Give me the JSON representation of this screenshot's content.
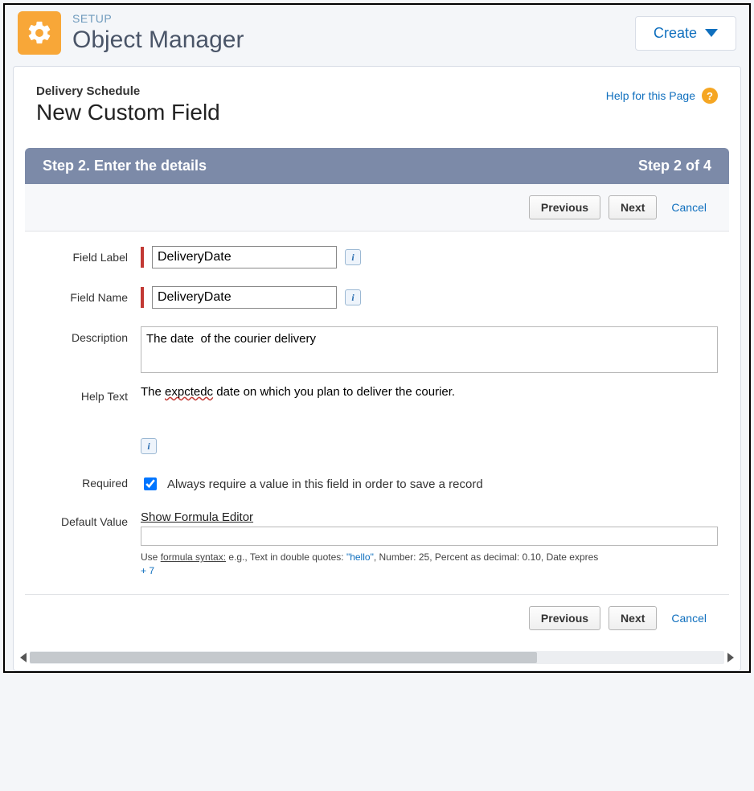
{
  "header": {
    "eyebrow": "SETUP",
    "title": "Object Manager",
    "create_label": "Create"
  },
  "panel": {
    "breadcrumb": "Delivery Schedule",
    "page_title": "New Custom Field",
    "help_link": "Help for this Page"
  },
  "step": {
    "left": "Step 2. Enter the details",
    "right": "Step 2 of 4"
  },
  "buttons": {
    "previous": "Previous",
    "next": "Next",
    "cancel": "Cancel"
  },
  "form": {
    "field_label": {
      "label": "Field Label",
      "value": "DeliveryDate"
    },
    "field_name": {
      "label": "Field Name",
      "value": "DeliveryDate"
    },
    "description": {
      "label": "Description",
      "value": "The date  of the courier delivery"
    },
    "help_text": {
      "label": "Help Text",
      "value_prefix": "The ",
      "value_err": "expctedc",
      "value_suffix": " date on which you plan to deliver the courier."
    },
    "required": {
      "label": "Required",
      "text": "Always require a value in this field in order to save a record",
      "checked": true
    },
    "default_value": {
      "label": "Default Value",
      "show_editor": "Show Formula Editor",
      "input": "",
      "hint_pre": "Use ",
      "hint_u": "formula syntax:",
      "hint_mid1": " e.g., Text in double quotes: ",
      "hint_q": "\"hello\"",
      "hint_mid2": ", Number: 25, Percent as decimal: 0.10, Date expres",
      "hint_line2": "+ 7"
    }
  }
}
